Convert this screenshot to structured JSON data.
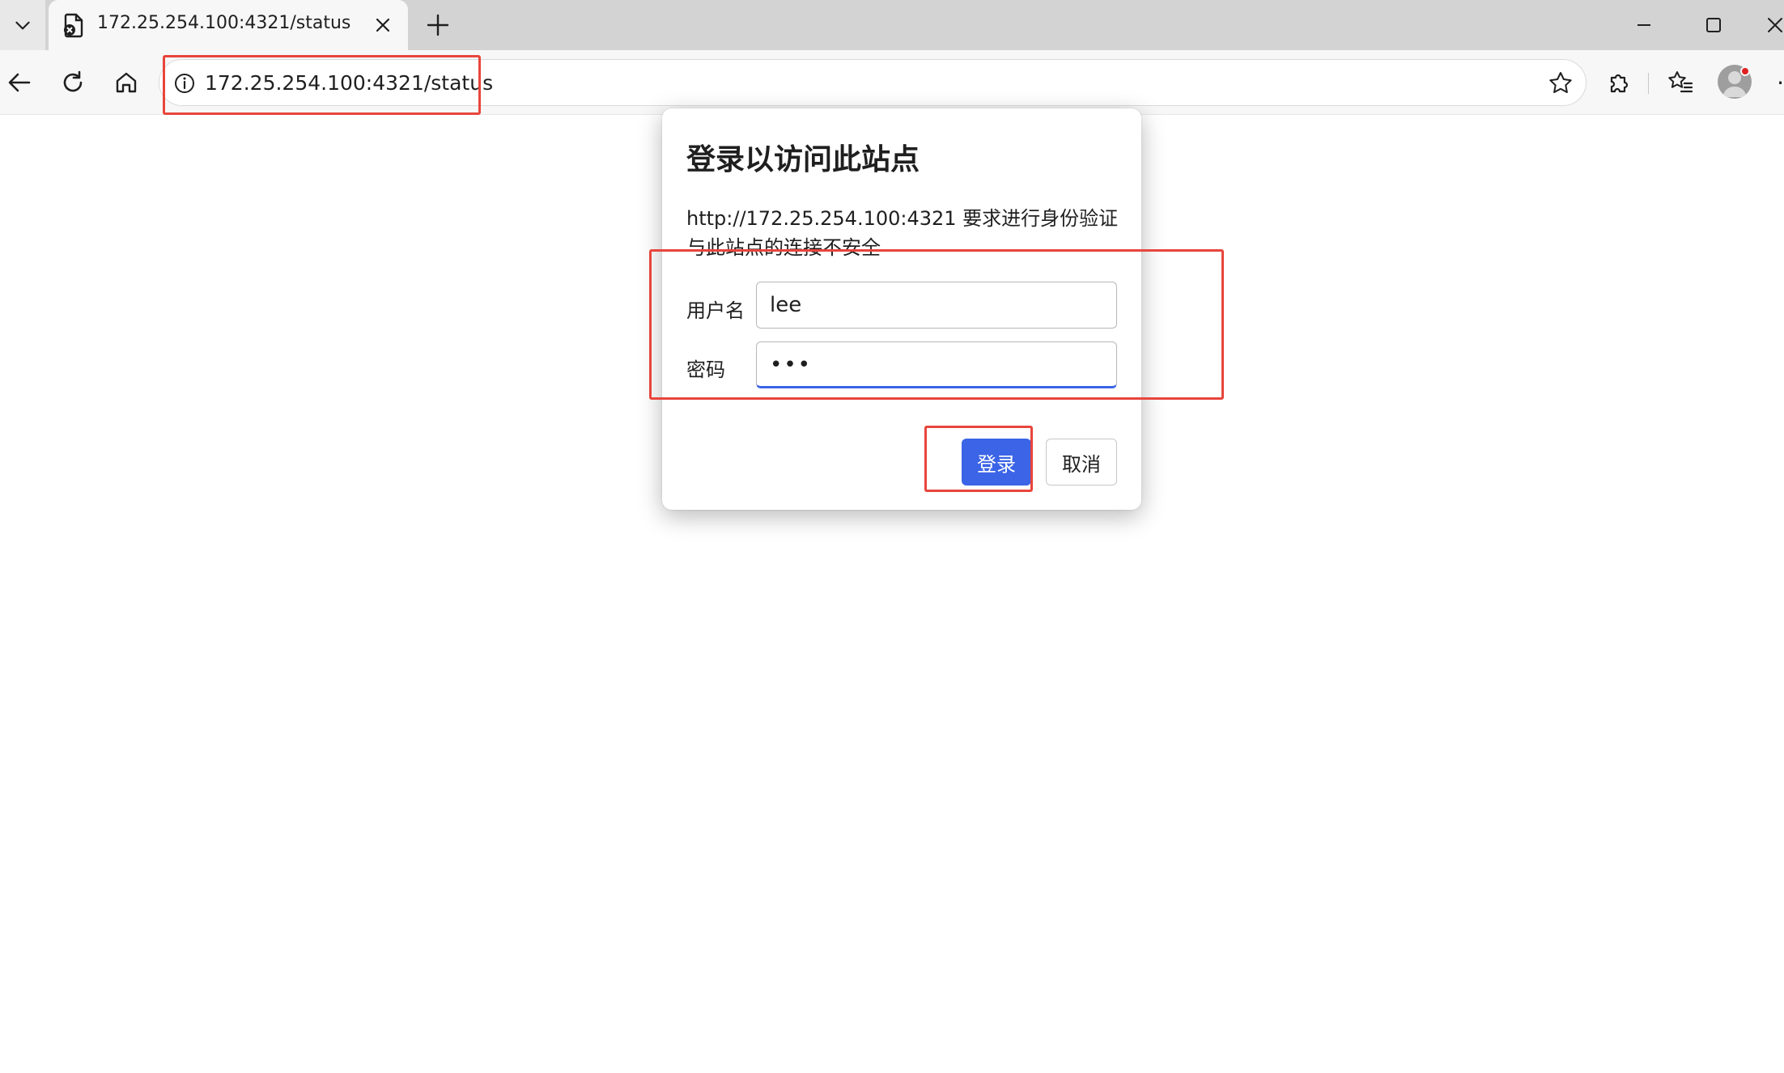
{
  "browser": {
    "tab": {
      "title": "172.25.254.100:4321/status",
      "favicon": "insecure-page-icon",
      "close_icon": "close-icon"
    },
    "icons": {
      "tab_menu": "chevron-down-icon",
      "new_tab": "plus-icon",
      "minimize": "minimize-icon",
      "maximize": "maximize-icon",
      "close": "close-icon"
    },
    "toolbar": {
      "address": "172.25.254.100:4321/status",
      "more_label": "·",
      "icons": [
        "back-arrow-icon",
        "reload-icon",
        "home-icon",
        "info-icon",
        "star-icon",
        "extensions-icon",
        "favorites-icon",
        "profile-avatar",
        "more-icon"
      ]
    }
  },
  "dialog": {
    "title": "登录以访问此站点",
    "origin_message": "http://172.25.254.100:4321 要求进行身份验证",
    "warning": "与此站点的连接不安全",
    "username": {
      "label": "用户名",
      "value": "lee"
    },
    "password": {
      "label": "密码",
      "masked_value": "•••"
    },
    "login_button": "登录",
    "cancel_button": "取消"
  },
  "colors": {
    "accent_blue": "#3b64e6",
    "annotation_red": "#e8453c",
    "tabstrip_bg": "#d3d3d3",
    "toolbar_bg": "#f7f7f7"
  }
}
